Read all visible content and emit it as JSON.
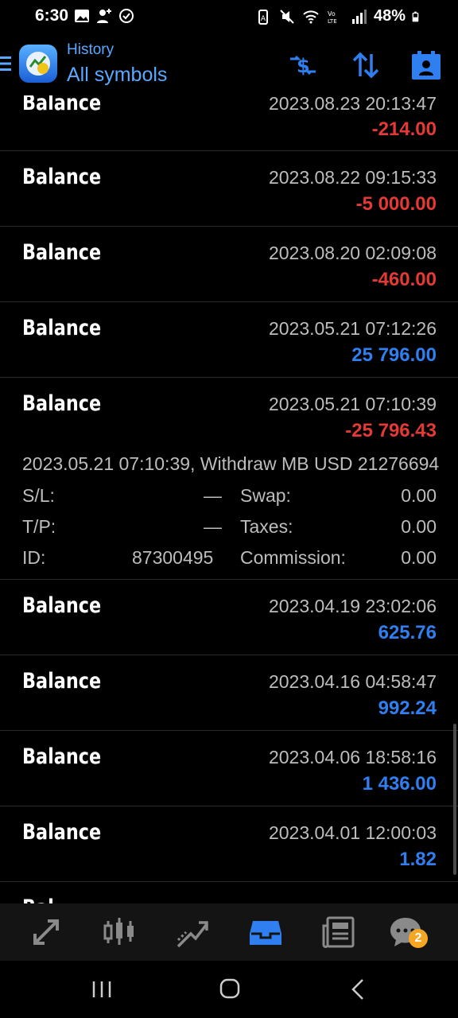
{
  "status_bar": {
    "time": "6:30",
    "battery": "48%"
  },
  "app_bar": {
    "title": "History",
    "subtitle": "All symbols",
    "icons": [
      "menu-icon",
      "app-logo",
      "currency-exchange-icon",
      "sort-icon",
      "calendar-icon"
    ]
  },
  "entries": [
    {
      "type": "Balance",
      "date": "2023.08.23 20:13:47",
      "amount": "-214.00",
      "sign": "neg"
    },
    {
      "type": "Balance",
      "date": "2023.08.22 09:15:33",
      "amount": "-5 000.00",
      "sign": "neg"
    },
    {
      "type": "Balance",
      "date": "2023.08.20 02:09:08",
      "amount": "-460.00",
      "sign": "neg"
    },
    {
      "type": "Balance",
      "date": "2023.05.21 07:12:26",
      "amount": "25 796.00",
      "sign": "pos"
    },
    {
      "type": "Balance",
      "date": "2023.05.21 07:10:39",
      "amount": "-25 796.43",
      "sign": "neg"
    },
    {
      "type": "Balance",
      "date": "2023.04.19 23:02:06",
      "amount": "625.76",
      "sign": "pos"
    },
    {
      "type": "Balance",
      "date": "2023.04.16 04:58:47",
      "amount": "992.24",
      "sign": "pos"
    },
    {
      "type": "Balance",
      "date": "2023.04.06 18:58:16",
      "amount": "1 436.00",
      "sign": "pos"
    },
    {
      "type": "Balance",
      "date": "2023.04.01 12:00:03",
      "amount": "1.82",
      "sign": "pos"
    }
  ],
  "partial_entry": {
    "type": "Bal"
  },
  "expanded_detail": {
    "comment": "2023.05.21 07:10:39, Withdraw MB USD 21276694",
    "sl_label": "S/L:",
    "sl_value": "—",
    "tp_label": "T/P:",
    "tp_value": "—",
    "id_label": "ID:",
    "id_value": "87300495",
    "swap_label": "Swap:",
    "swap_value": "0.00",
    "taxes_label": "Taxes:",
    "taxes_value": "0.00",
    "commission_label": "Commission:",
    "commission_value": "0.00"
  },
  "bottom_nav": {
    "items": [
      "quotes-icon",
      "chart-icon",
      "trade-icon",
      "history-icon",
      "news-icon",
      "chat-icon"
    ],
    "active": "history-icon",
    "chat_badge": "2"
  },
  "colors": {
    "negative": "#e53935",
    "positive": "#2f7ff0",
    "accent": "#5aa8ff"
  }
}
